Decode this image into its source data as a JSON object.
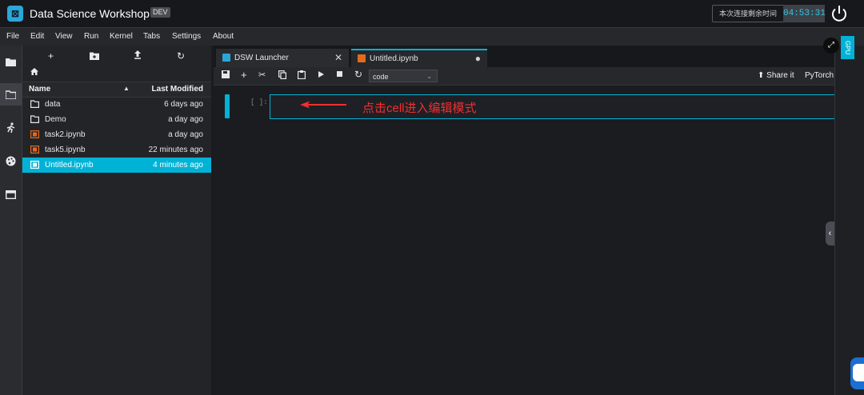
{
  "header": {
    "logo_glyph": "⊠",
    "app_title": "Data Science Workshop",
    "env_badge": "DEV",
    "timer_label": "本次连接剩余时间",
    "timer_value": "04:53:31"
  },
  "menu": [
    "File",
    "Edit",
    "View",
    "Run",
    "Kernel",
    "Tabs",
    "Settings",
    "About"
  ],
  "file_browser": {
    "columns": {
      "name": "Name",
      "modified": "Last Modified"
    },
    "files": [
      {
        "name": "data",
        "modified": "6 days ago",
        "type": "folder"
      },
      {
        "name": "Demo",
        "modified": "a day ago",
        "type": "folder"
      },
      {
        "name": "task2.ipynb",
        "modified": "a day ago",
        "type": "notebook"
      },
      {
        "name": "task5.ipynb",
        "modified": "22 minutes ago",
        "type": "notebook"
      },
      {
        "name": "Untitled.ipynb",
        "modified": "4 minutes ago",
        "type": "notebook",
        "selected": true
      }
    ]
  },
  "tabs": [
    {
      "label": "DSW Launcher",
      "active": false
    },
    {
      "label": "Untitled.ipynb",
      "active": true
    }
  ],
  "notebook_toolbar": {
    "cell_type": "code",
    "share_label": "Share it",
    "kernel_label": "PyTorch"
  },
  "cell": {
    "prompt": "[ ]:"
  },
  "annotation": {
    "text": "点击cell进入编辑模式"
  },
  "right_panel": {
    "gpu_label": "GPU"
  },
  "colors": {
    "accent": "#00b3d6",
    "timer_text": "#34c5e4",
    "annotation": "#f02e2e",
    "notebook_icon": "#e06b1f"
  }
}
